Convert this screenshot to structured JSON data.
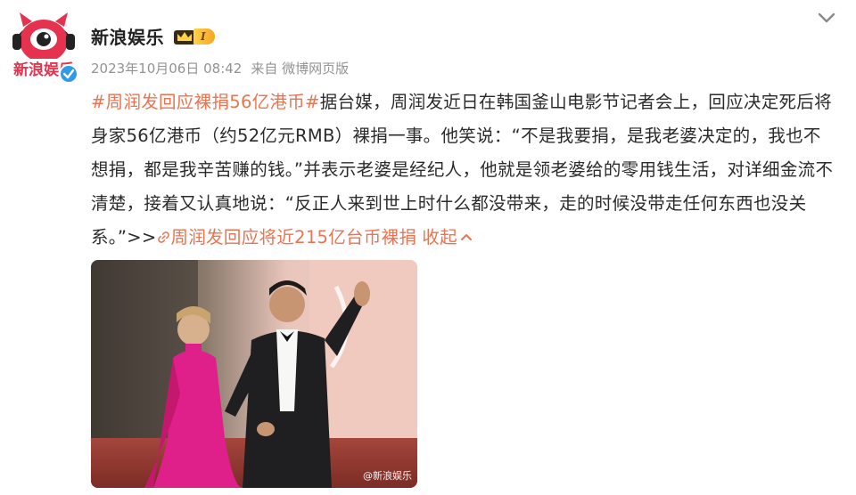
{
  "post": {
    "author": {
      "name": "新浪娱乐",
      "avatar_text": "新浪娱乐",
      "vip_level": "I"
    },
    "meta": {
      "date": "2023年10月06日 08:42",
      "source": "来自 微博网页版"
    },
    "topic": "#周润发回应裸捐56亿港币#",
    "body": "据台媒，周润发近日在韩国釜山电影节记者会上，回应决定死后将身家56亿港币（约52亿元RMB）裸捐一事。他笑说：“不是我要捐，是我老婆决定的，我也不想捐，都是我辛苦赚的钱。”并表示老婆是经纪人，他就是领老婆给的零用钱生活，对详细金流不清楚，接着又认真地说：“反正人来到世上时什么都没带来，走的时候没带走任何东西也没关系。”>>",
    "link_text": "周润发回应将近215亿台币裸捐",
    "collapse_text": "收起",
    "photo_watermark": "@新浪娱乐"
  },
  "colors": {
    "accent": "#eb7350",
    "meta_gray": "#939393",
    "verified_blue": "#2f9be8",
    "vip_gold": "#f5a623"
  },
  "icons": [
    "weibo-mascot-avatar",
    "verified-badge-icon",
    "vip-crown-icon",
    "chevron-down-icon",
    "link-icon",
    "chevron-up-icon"
  ]
}
